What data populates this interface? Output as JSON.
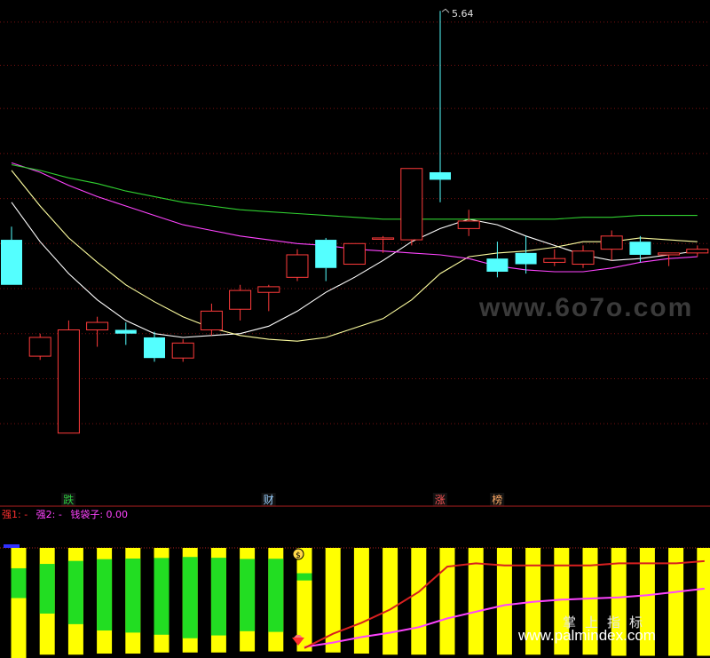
{
  "peak_label": "5.64",
  "markers": [
    {
      "char": "跌",
      "color": "#2ecc40",
      "index": 1
    },
    {
      "char": "财",
      "color": "#9ad0ff",
      "index": 8
    },
    {
      "char": "涨",
      "color": "#ff5555",
      "index": 14
    },
    {
      "char": "榜",
      "color": "#ffaa66",
      "index": 16
    }
  ],
  "indicator": {
    "qiang1": "强1: -",
    "qiang2": "强2: -",
    "qiandaizi": "钱袋子: 0.00",
    "colors": {
      "qiang1": "#ff3030",
      "qiang2": "#ff44ff",
      "qiandaizi": "#ff44ff"
    }
  },
  "watermarks": {
    "site1": "www.6o7o.com",
    "cn": "掌上指标",
    "site2": "www.palmindex.com"
  },
  "chart_data": {
    "type": "candlestick",
    "price_range": [
      3.25,
      5.72
    ],
    "candles": [
      {
        "o": 4.48,
        "c": 4.24,
        "h": 4.55,
        "l": 4.24
      },
      {
        "o": 3.86,
        "c": 3.96,
        "h": 3.98,
        "l": 3.84
      },
      {
        "o": 3.45,
        "c": 4.0,
        "h": 4.05,
        "l": 3.45
      },
      {
        "o": 4.0,
        "c": 4.04,
        "h": 4.07,
        "l": 3.91
      },
      {
        "o": 4.0,
        "c": 3.98,
        "h": 4.04,
        "l": 3.92
      },
      {
        "o": 3.96,
        "c": 3.85,
        "h": 3.99,
        "l": 3.83
      },
      {
        "o": 3.85,
        "c": 3.93,
        "h": 3.95,
        "l": 3.83
      },
      {
        "o": 4.0,
        "c": 4.1,
        "h": 4.14,
        "l": 3.97
      },
      {
        "o": 4.11,
        "c": 4.21,
        "h": 4.24,
        "l": 4.05
      },
      {
        "o": 4.2,
        "c": 4.23,
        "h": 4.24,
        "l": 4.1
      },
      {
        "o": 4.28,
        "c": 4.4,
        "h": 4.43,
        "l": 4.26
      },
      {
        "o": 4.48,
        "c": 4.33,
        "h": 4.49,
        "l": 4.26
      },
      {
        "o": 4.35,
        "c": 4.46,
        "h": 4.46,
        "l": 4.35
      },
      {
        "o": 4.49,
        "c": 4.49,
        "h": 4.5,
        "l": 4.41
      },
      {
        "o": 4.48,
        "c": 4.86,
        "h": 4.86,
        "l": 4.45
      },
      {
        "o": 4.84,
        "c": 4.8,
        "h": 5.7,
        "l": 4.68
      },
      {
        "o": 4.54,
        "c": 4.58,
        "h": 4.64,
        "l": 4.5
      },
      {
        "o": 4.38,
        "c": 4.31,
        "h": 4.47,
        "l": 4.28
      },
      {
        "o": 4.41,
        "c": 4.35,
        "h": 4.5,
        "l": 4.3
      },
      {
        "o": 4.36,
        "c": 4.38,
        "h": 4.43,
        "l": 4.34
      },
      {
        "o": 4.35,
        "c": 4.42,
        "h": 4.45,
        "l": 4.33
      },
      {
        "o": 4.43,
        "c": 4.5,
        "h": 4.53,
        "l": 4.37
      },
      {
        "o": 4.47,
        "c": 4.4,
        "h": 4.5,
        "l": 4.36
      },
      {
        "o": 4.4,
        "c": 4.41,
        "h": 4.41,
        "l": 4.34
      },
      {
        "o": 4.41,
        "c": 4.43,
        "h": 4.45,
        "l": 4.39
      }
    ],
    "ma": [
      {
        "color": "#ffffff",
        "values": [
          4.68,
          4.47,
          4.3,
          4.16,
          4.05,
          3.98,
          3.96,
          3.97,
          3.98,
          4.02,
          4.1,
          4.2,
          4.28,
          4.37,
          4.47,
          4.54,
          4.59,
          4.56,
          4.5,
          4.45,
          4.4,
          4.37,
          4.38,
          4.4,
          4.42
        ]
      },
      {
        "color": "#ffffa0",
        "values": [
          4.85,
          4.66,
          4.49,
          4.36,
          4.24,
          4.15,
          4.07,
          4.01,
          3.97,
          3.95,
          3.94,
          3.96,
          4.01,
          4.06,
          4.16,
          4.3,
          4.39,
          4.41,
          4.42,
          4.44,
          4.47,
          4.47,
          4.49,
          4.48,
          4.47
        ]
      },
      {
        "color": "#ff44ff",
        "values": [
          4.89,
          4.84,
          4.77,
          4.71,
          4.66,
          4.61,
          4.56,
          4.53,
          4.5,
          4.48,
          4.46,
          4.45,
          4.43,
          4.42,
          4.41,
          4.4,
          4.38,
          4.34,
          4.32,
          4.31,
          4.31,
          4.33,
          4.36,
          4.38,
          4.39
        ]
      },
      {
        "color": "#30d030",
        "values": [
          4.88,
          4.85,
          4.81,
          4.78,
          4.74,
          4.71,
          4.68,
          4.66,
          4.64,
          4.63,
          4.62,
          4.61,
          4.6,
          4.59,
          4.59,
          4.59,
          4.59,
          4.59,
          4.59,
          4.59,
          4.6,
          4.6,
          4.61,
          4.61,
          4.61
        ]
      }
    ],
    "gridlines": [
      5.64,
      5.41,
      5.18,
      4.94,
      4.7,
      4.46,
      4.22,
      3.98,
      3.74,
      3.5
    ],
    "indicator_panel": {
      "range": [
        0,
        100
      ],
      "yellow_bar": [
        100,
        97,
        97,
        96,
        96,
        95,
        95,
        95,
        94,
        94,
        94,
        95,
        96,
        97,
        97,
        97,
        97,
        97,
        97,
        97,
        97,
        98,
        98,
        98,
        98
      ],
      "green_bar": [
        33,
        55,
        70,
        79,
        82,
        85,
        90,
        86,
        80,
        81,
        8,
        0,
        0,
        0,
        0,
        0,
        0,
        0,
        0,
        0,
        0,
        0,
        0,
        0,
        0
      ],
      "strong_line": [
        null,
        null,
        null,
        null,
        null,
        null,
        null,
        null,
        null,
        null,
        9,
        22,
        32,
        44,
        60,
        83,
        86,
        84,
        84,
        84,
        84,
        86,
        86,
        86,
        88
      ],
      "bag_line": [
        null,
        null,
        null,
        null,
        null,
        null,
        null,
        null,
        null,
        null,
        10,
        14,
        19,
        23,
        28,
        36,
        42,
        48,
        51,
        53,
        54,
        55,
        57,
        60,
        63
      ]
    }
  }
}
